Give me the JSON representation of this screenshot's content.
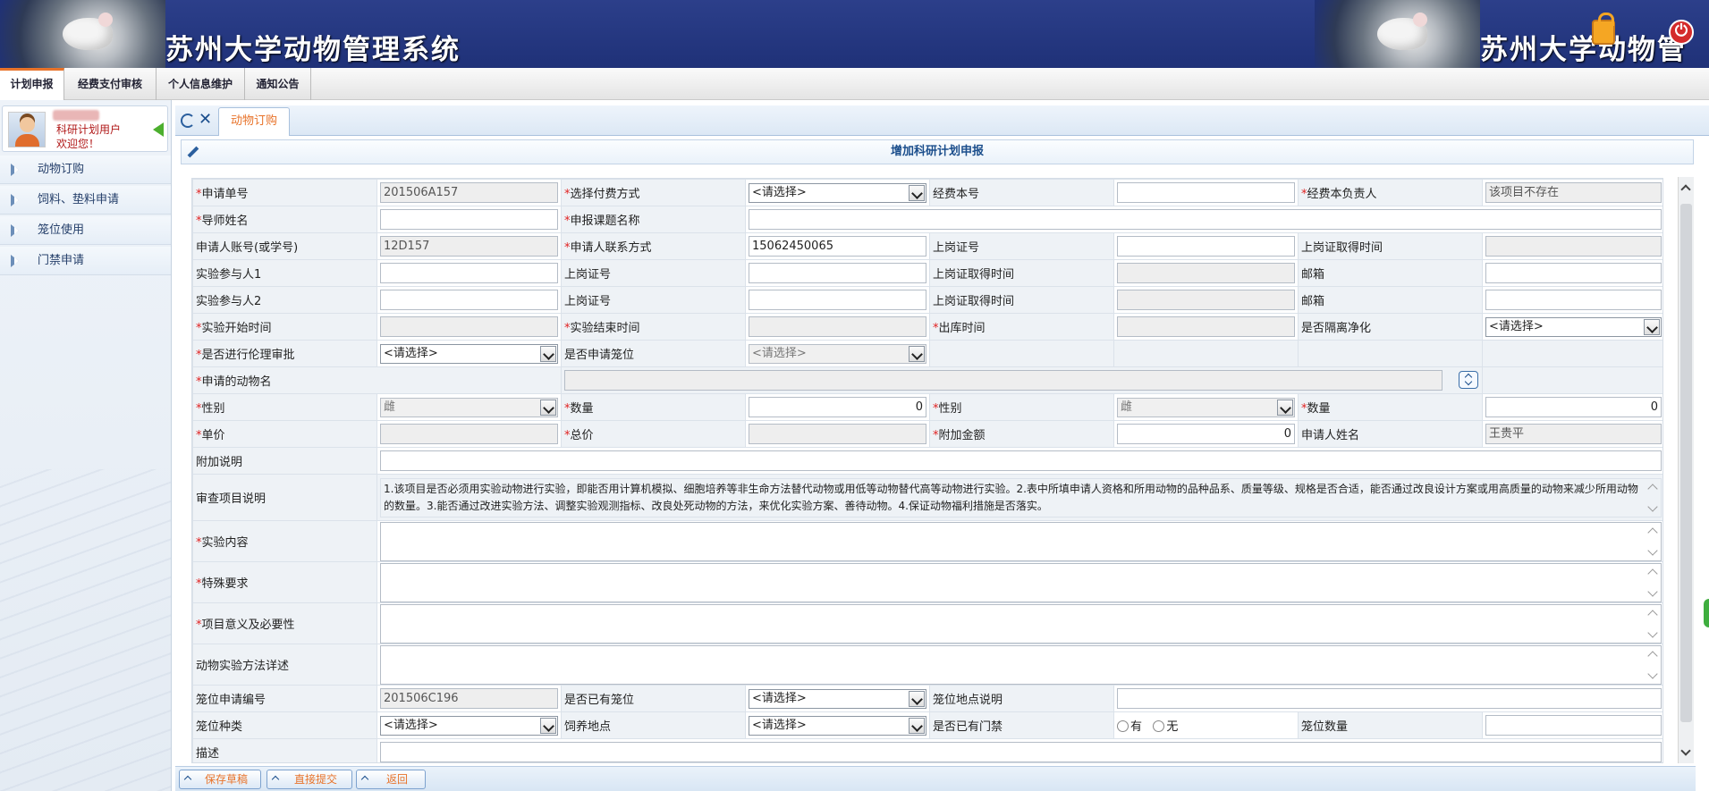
{
  "app": {
    "title": "苏州大学动物管理系统",
    "title_repeat": "苏州大学动物管"
  },
  "colors": {
    "banner": "#1f3178",
    "accent": "#e8732a",
    "required": "#e02020",
    "link": "#1b4e8c"
  },
  "topnav": [
    {
      "label": "计划申报",
      "active": true
    },
    {
      "label": "经费支付审核"
    },
    {
      "label": "个人信息维护"
    },
    {
      "label": "通知公告"
    }
  ],
  "user": {
    "role": "科研计划用户",
    "welcome": "欢迎您！"
  },
  "sidebar": {
    "items": [
      {
        "label": "动物订购"
      },
      {
        "label": "饲料、垫料申请"
      },
      {
        "label": "笼位使用"
      },
      {
        "label": "门禁申请"
      }
    ]
  },
  "tab": {
    "label": "动物订购"
  },
  "form": {
    "title": "增加科研计划申报",
    "select_default": "<请选择>",
    "sex_default": "雌",
    "f": {
      "apply_no": {
        "label": "申请单号",
        "value": "201506A157"
      },
      "pay_method": {
        "label": "选择付费方式"
      },
      "fund_no": {
        "label": "经费本号"
      },
      "fund_owner": {
        "label": "经费本负责人",
        "value": "该项目不存在"
      },
      "tutor": {
        "label": "导师姓名"
      },
      "topic": {
        "label": "申报课题名称"
      },
      "account": {
        "label": "申请人账号(或学号)",
        "value": "12D157"
      },
      "phone": {
        "label": "申请人联系方式",
        "value": "15062450065"
      },
      "cert": {
        "label": "上岗证号"
      },
      "cert_time": {
        "label": "上岗证取得时间"
      },
      "p1": {
        "label": "实验参与人1"
      },
      "p2": {
        "label": "实验参与人2"
      },
      "email": {
        "label": "邮箱"
      },
      "start": {
        "label": "实验开始时间"
      },
      "end": {
        "label": "实验结束时间"
      },
      "out": {
        "label": "出库时间"
      },
      "isolate": {
        "label": "是否隔离净化"
      },
      "ethics": {
        "label": "是否进行伦理审批"
      },
      "cage_req": {
        "label": "是否申请笼位"
      },
      "animal": {
        "label": "申请的动物名"
      },
      "sex": {
        "label": "性别"
      },
      "qty": {
        "label": "数量",
        "value": "0"
      },
      "unit_price": {
        "label": "单价"
      },
      "total": {
        "label": "总价"
      },
      "extra": {
        "label": "附加金额",
        "value": "0"
      },
      "applicant": {
        "label": "申请人姓名",
        "value": "王贵平"
      },
      "note": {
        "label": "附加说明"
      },
      "review": {
        "label": "审查项目说明",
        "value": "1.该项目是否必须用实验动物进行实验，即能否用计算机模拟、细胞培养等非生命方法替代动物或用低等动物替代高等动物进行实验。2.表中所填申请人资格和所用动物的品种品系、质量等级、规格是否合适，能否通过改良设计方案或用高质量的动物来减少所用动物的数量。3.能否通过改进实验方法、调整实验观测指标、改良处死动物的方法，来优化实验方案、善待动物。4.保证动物福利措施是否落实。"
      },
      "content": {
        "label": "实验内容"
      },
      "special": {
        "label": "特殊要求"
      },
      "significance": {
        "label": "项目意义及必要性"
      },
      "method": {
        "label": "动物实验方法详述"
      },
      "cage_no": {
        "label": "笼位申请编号",
        "value": "201506C196"
      },
      "has_cage": {
        "label": "是否已有笼位"
      },
      "cage_place": {
        "label": "笼位地点说明"
      },
      "cage_type": {
        "label": "笼位种类"
      },
      "feed_place": {
        "label": "饲养地点"
      },
      "door": {
        "label": "是否已有门禁",
        "yes": "有",
        "no": "无"
      },
      "cage_count": {
        "label": "笼位数量"
      },
      "desc": {
        "label": "描述"
      }
    }
  },
  "buttons": {
    "save": "保存草稿",
    "submit": "直接提交",
    "back": "返回"
  }
}
